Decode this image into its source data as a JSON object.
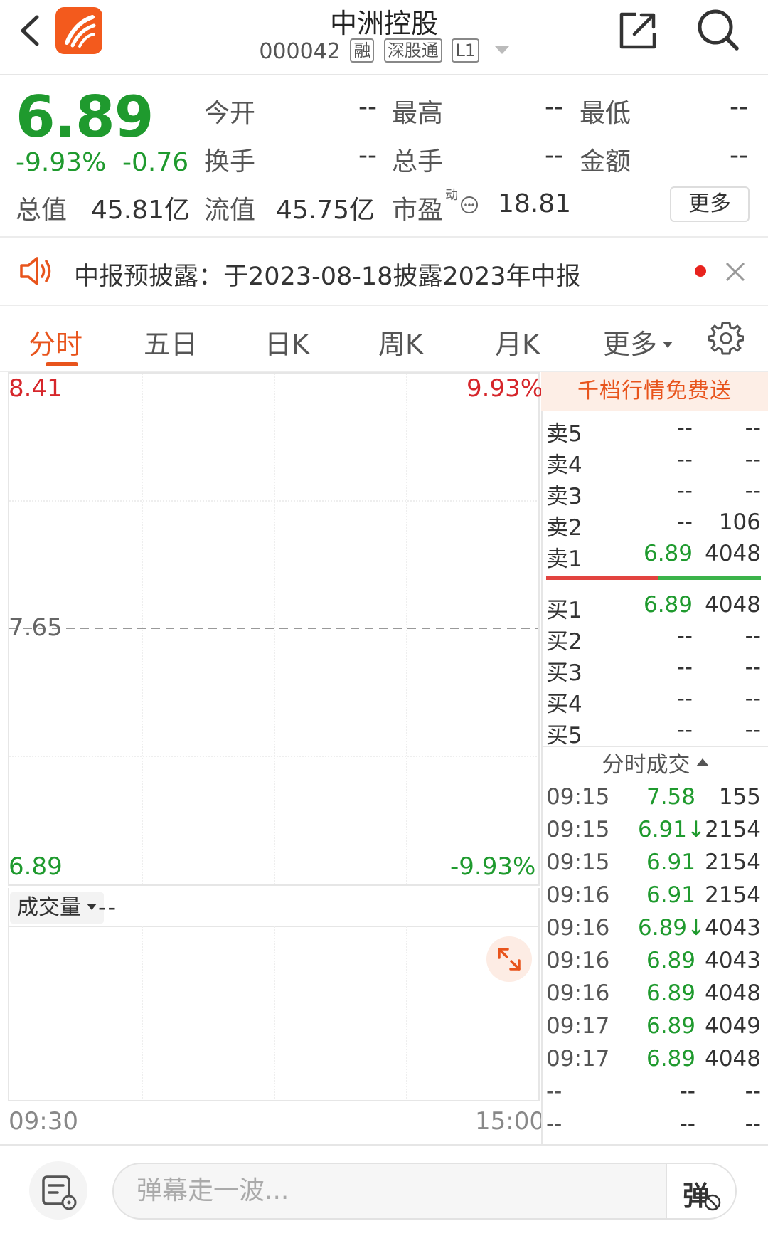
{
  "header": {
    "title": "中洲控股",
    "code": "000042",
    "tags": [
      "融",
      "深股通",
      "L1"
    ]
  },
  "quote": {
    "price": "6.89",
    "change_pct": "-9.93%",
    "change": "-0.76",
    "fields": [
      {
        "label": "今开",
        "value": "--"
      },
      {
        "label": "最高",
        "value": "--"
      },
      {
        "label": "最低",
        "value": "--"
      },
      {
        "label": "换手",
        "value": "--"
      },
      {
        "label": "总手",
        "value": "--"
      },
      {
        "label": "金额",
        "value": "--"
      }
    ],
    "market_cap_label": "总值",
    "market_cap": "45.81亿",
    "float_cap_label": "流值",
    "float_cap": "45.75亿",
    "pe_label": "市盈",
    "pe_superscript": "动",
    "pe_value": "18.81",
    "more_label": "更多"
  },
  "notice": {
    "text": "中报预披露：于2023-08-18披露2023年中报"
  },
  "tabs": [
    {
      "label": "分时",
      "active": true
    },
    {
      "label": "五日"
    },
    {
      "label": "日K"
    },
    {
      "label": "周K"
    },
    {
      "label": "月K"
    },
    {
      "label": "更多"
    }
  ],
  "chart": {
    "y_top": "8.41",
    "y_mid": "7.65",
    "y_bottom": "6.89",
    "pct_top": "9.93%",
    "pct_bottom": "-9.93%",
    "time_start": "09:30",
    "time_end": "15:00",
    "volume_label": "成交量",
    "volume_value": "--"
  },
  "chart_data": {
    "type": "line",
    "title": "",
    "series": [],
    "x": [],
    "xlabel": "",
    "ylabel": "",
    "ylim": [
      6.89,
      8.41
    ],
    "y_ticks": [
      "8.41",
      "7.65",
      "6.89"
    ],
    "y2_ticks": [
      "9.93%",
      "-9.93%"
    ],
    "x_ticks": [
      "09:30",
      "15:00"
    ],
    "reference_line": 7.65,
    "grid": true
  },
  "orderbook": {
    "banner": "千档行情免费送",
    "asks": [
      {
        "label": "卖5",
        "price": "--",
        "vol": "--"
      },
      {
        "label": "卖4",
        "price": "--",
        "vol": "--"
      },
      {
        "label": "卖3",
        "price": "--",
        "vol": "--"
      },
      {
        "label": "卖2",
        "price": "--",
        "vol": "106"
      },
      {
        "label": "卖1",
        "price": "6.89",
        "vol": "4048"
      }
    ],
    "bids": [
      {
        "label": "买1",
        "price": "6.89",
        "vol": "4048"
      },
      {
        "label": "买2",
        "price": "--",
        "vol": "--"
      },
      {
        "label": "买3",
        "price": "--",
        "vol": "--"
      },
      {
        "label": "买4",
        "price": "--",
        "vol": "--"
      },
      {
        "label": "买5",
        "price": "--",
        "vol": "--"
      }
    ]
  },
  "ticks": {
    "header": "分时成交",
    "rows": [
      {
        "time": "09:15",
        "price": "7.58",
        "vol": "155"
      },
      {
        "time": "09:15",
        "price": "6.91↓",
        "vol": "2154"
      },
      {
        "time": "09:15",
        "price": "6.91",
        "vol": "2154"
      },
      {
        "time": "09:16",
        "price": "6.91",
        "vol": "2154"
      },
      {
        "time": "09:16",
        "price": "6.89↓",
        "vol": "4043"
      },
      {
        "time": "09:16",
        "price": "6.89",
        "vol": "4043"
      },
      {
        "time": "09:16",
        "price": "6.89",
        "vol": "4048"
      },
      {
        "time": "09:17",
        "price": "6.89",
        "vol": "4049"
      },
      {
        "time": "09:17",
        "price": "6.89",
        "vol": "4048"
      },
      {
        "time": "--",
        "price": "--",
        "vol": "--"
      },
      {
        "time": "--",
        "price": "--",
        "vol": "--"
      }
    ]
  },
  "bottom": {
    "placeholder": "弹幕走一波...",
    "danmu_glyph": "弹"
  },
  "colors": {
    "accent": "#e8541c",
    "down_green": "#1f9a2e",
    "up_red": "#d6262b"
  },
  "icons": [
    "back-icon",
    "app-logo-icon",
    "share-icon",
    "search-icon",
    "speaker-icon",
    "close-icon",
    "gear-icon",
    "expand-icon",
    "note-icon"
  ]
}
